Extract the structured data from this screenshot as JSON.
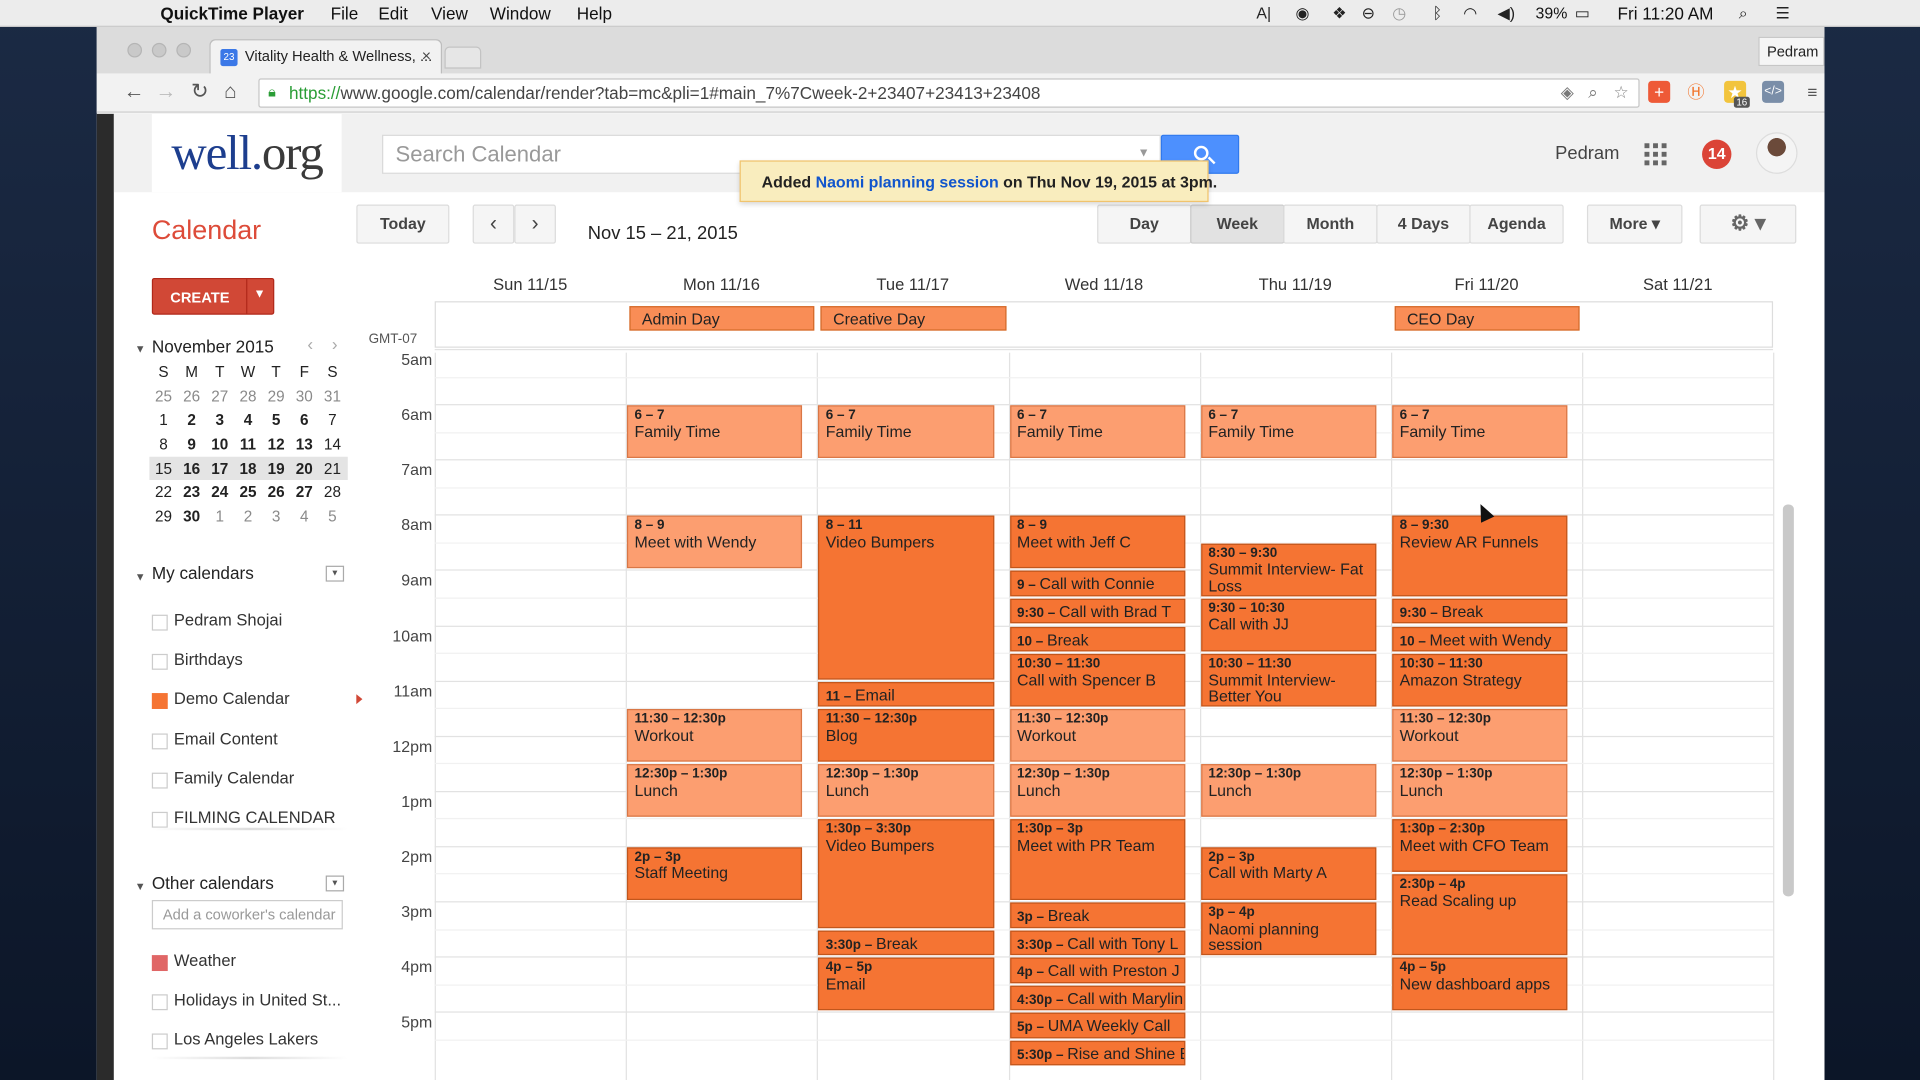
{
  "menubar": {
    "app_name": "QuickTime Player",
    "menus": [
      "File",
      "Edit",
      "View",
      "Window",
      "Help"
    ],
    "battery": "39%",
    "clock": "Fri 11:20 AM"
  },
  "browser": {
    "tab_title": "Vitality Health & Wellness, ...",
    "tab_favicon_text": "23",
    "profile_button": "Pedram",
    "url_https": "https://",
    "url_rest": "www.google.com/calendar/render?tab=mc&pli=1#main_7%7Cweek-2+23407+23413+23408",
    "extension_badge": "16"
  },
  "header": {
    "logo_main": "well.",
    "logo_suffix": "org",
    "search_placeholder": "Search Calendar",
    "user_name": "Pedram",
    "notification_count": "14"
  },
  "toast": {
    "prefix": "Added ",
    "event_name": "Naomi planning session",
    "suffix": " on Thu Nov 19, 2015 at 3pm."
  },
  "toolbar": {
    "title": "Calendar",
    "today": "Today",
    "prev_icon": "chevron-left-icon",
    "next_icon": "chevron-right-icon",
    "date_range": "Nov 15 – 21, 2015",
    "views": [
      "Day",
      "Week",
      "Month",
      "4 Days",
      "Agenda"
    ],
    "active_view": "Week",
    "more": "More ▾",
    "settings_icon": "gear-icon"
  },
  "sidebar": {
    "create": "CREATE",
    "month_title": "November 2015",
    "weekday_initials": [
      "S",
      "M",
      "T",
      "W",
      "T",
      "F",
      "S"
    ],
    "weeks": [
      [
        "25",
        "26",
        "27",
        "28",
        "29",
        "30",
        "31"
      ],
      [
        "1",
        "2",
        "3",
        "4",
        "5",
        "6",
        "7"
      ],
      [
        "8",
        "9",
        "10",
        "11",
        "12",
        "13",
        "14"
      ],
      [
        "15",
        "16",
        "17",
        "18",
        "19",
        "20",
        "21"
      ],
      [
        "22",
        "23",
        "24",
        "25",
        "26",
        "27",
        "28"
      ],
      [
        "29",
        "30",
        "1",
        "2",
        "3",
        "4",
        "5"
      ]
    ],
    "my_calendars_title": "My calendars",
    "my_calendars": [
      {
        "label": "Pedram Shojai",
        "color": ""
      },
      {
        "label": "Birthdays",
        "color": ""
      },
      {
        "label": "Demo Calendar",
        "color": "#f57433"
      },
      {
        "label": "Email Content",
        "color": ""
      },
      {
        "label": "Family Calendar",
        "color": ""
      },
      {
        "label": "FILMING CALENDAR",
        "color": ""
      }
    ],
    "other_calendars_title": "Other calendars",
    "add_coworker_placeholder": "Add a coworker's calendar",
    "other_calendars": [
      {
        "label": "Weather",
        "color": "#e06666"
      },
      {
        "label": "Holidays in United St...",
        "color": ""
      },
      {
        "label": "Los Angeles Lakers",
        "color": ""
      }
    ]
  },
  "week_view": {
    "timezone": "GMT-07",
    "days": [
      "Sun 11/15",
      "Mon 11/16",
      "Tue 11/17",
      "Wed 11/18",
      "Thu 11/19",
      "Fri 11/20",
      "Sat 11/21"
    ],
    "hours": [
      "5am",
      "6am",
      "7am",
      "8am",
      "9am",
      "10am",
      "11am",
      "12pm",
      "1pm",
      "2pm",
      "3pm",
      "4pm",
      "5pm"
    ],
    "all_day_events": [
      {
        "day": 1,
        "title": "Admin Day"
      },
      {
        "day": 2,
        "title": "Creative Day"
      },
      {
        "day": 5,
        "title": "CEO Day"
      }
    ],
    "events": [
      {
        "day": 1,
        "start": 6,
        "end": 7,
        "time": "6 – 7",
        "title": "Family Time",
        "shade": "light"
      },
      {
        "day": 2,
        "start": 6,
        "end": 7,
        "time": "6 – 7",
        "title": "Family Time",
        "shade": "light"
      },
      {
        "day": 3,
        "start": 6,
        "end": 7,
        "time": "6 – 7",
        "title": "Family Time",
        "shade": "light"
      },
      {
        "day": 4,
        "start": 6,
        "end": 7,
        "time": "6 – 7",
        "title": "Family Time",
        "shade": "light"
      },
      {
        "day": 5,
        "start": 6,
        "end": 7,
        "time": "6 – 7",
        "title": "Family Time",
        "shade": "light"
      },
      {
        "day": 1,
        "start": 8,
        "end": 9,
        "time": "8 – 9",
        "title": "Meet with Wendy",
        "shade": "light"
      },
      {
        "day": 1,
        "start": 11.5,
        "end": 12.5,
        "time": "11:30 – 12:30p",
        "title": "Workout",
        "shade": "light"
      },
      {
        "day": 1,
        "start": 12.5,
        "end": 13.5,
        "time": "12:30p – 1:30p",
        "title": "Lunch",
        "shade": "light"
      },
      {
        "day": 1,
        "start": 14,
        "end": 15,
        "time": "2p – 3p",
        "title": "Staff Meeting",
        "shade": "dark"
      },
      {
        "day": 2,
        "start": 8,
        "end": 11,
        "time": "8 – 11",
        "title": "Video Bumpers",
        "shade": "dark"
      },
      {
        "day": 2,
        "start": 11,
        "end": 11.5,
        "time": "11 – ",
        "title": "Email",
        "shade": "dark",
        "inline": true
      },
      {
        "day": 2,
        "start": 11.5,
        "end": 12.5,
        "time": "11:30 – 12:30p",
        "title": "Blog",
        "shade": "dark"
      },
      {
        "day": 2,
        "start": 12.5,
        "end": 13.5,
        "time": "12:30p – 1:30p",
        "title": "Lunch",
        "shade": "light"
      },
      {
        "day": 2,
        "start": 13.5,
        "end": 15.5,
        "time": "1:30p – 3:30p",
        "title": "Video Bumpers",
        "shade": "dark"
      },
      {
        "day": 2,
        "start": 15.5,
        "end": 16,
        "time": "3:30p – ",
        "title": "Break",
        "shade": "dark",
        "inline": true
      },
      {
        "day": 2,
        "start": 16,
        "end": 17,
        "time": "4p – 5p",
        "title": "Email",
        "shade": "dark"
      },
      {
        "day": 3,
        "start": 8,
        "end": 9,
        "time": "8 – 9",
        "title": "Meet with Jeff C",
        "shade": "dark"
      },
      {
        "day": 3,
        "start": 9,
        "end": 9.5,
        "time": "9 – ",
        "title": "Call with Connie",
        "shade": "dark",
        "inline": true
      },
      {
        "day": 3,
        "start": 9.5,
        "end": 10,
        "time": "9:30 – ",
        "title": "Call with Brad T",
        "shade": "dark",
        "inline": true
      },
      {
        "day": 3,
        "start": 10,
        "end": 10.5,
        "time": "10 – ",
        "title": "Break",
        "shade": "dark",
        "inline": true
      },
      {
        "day": 3,
        "start": 10.5,
        "end": 11.5,
        "time": "10:30 – 11:30",
        "title": "Call with Spencer B",
        "shade": "dark"
      },
      {
        "day": 3,
        "start": 11.5,
        "end": 12.5,
        "time": "11:30 – 12:30p",
        "title": "Workout",
        "shade": "light"
      },
      {
        "day": 3,
        "start": 12.5,
        "end": 13.5,
        "time": "12:30p – 1:30p",
        "title": "Lunch",
        "shade": "light"
      },
      {
        "day": 3,
        "start": 13.5,
        "end": 15,
        "time": "1:30p – 3p",
        "title": "Meet with PR Team",
        "shade": "dark"
      },
      {
        "day": 3,
        "start": 15,
        "end": 15.5,
        "time": "3p – ",
        "title": "Break",
        "shade": "dark",
        "inline": true
      },
      {
        "day": 3,
        "start": 15.5,
        "end": 16,
        "time": "3:30p – ",
        "title": "Call with Tony L",
        "shade": "dark",
        "inline": true
      },
      {
        "day": 3,
        "start": 16,
        "end": 16.5,
        "time": "4p – ",
        "title": "Call with Preston J",
        "shade": "dark",
        "inline": true
      },
      {
        "day": 3,
        "start": 16.5,
        "end": 17,
        "time": "4:30p – ",
        "title": "Call with Marylin",
        "shade": "dark",
        "inline": true
      },
      {
        "day": 3,
        "start": 17,
        "end": 17.5,
        "time": "5p – ",
        "title": "UMA Weekly Call",
        "shade": "dark",
        "inline": true
      },
      {
        "day": 3,
        "start": 17.5,
        "end": 18,
        "time": "5:30p – ",
        "title": "Rise and Shine E",
        "shade": "dark",
        "inline": true
      },
      {
        "day": 4,
        "start": 8.5,
        "end": 9.5,
        "time": "8:30 – 9:30",
        "title": "Summit Interview- Fat Loss",
        "shade": "dark"
      },
      {
        "day": 4,
        "start": 9.5,
        "end": 10.5,
        "time": "9:30 – 10:30",
        "title": "Call with JJ",
        "shade": "dark"
      },
      {
        "day": 4,
        "start": 10.5,
        "end": 11.5,
        "time": "10:30 – 11:30",
        "title": "Summit Interview- Better You",
        "shade": "dark"
      },
      {
        "day": 4,
        "start": 12.5,
        "end": 13.5,
        "time": "12:30p – 1:30p",
        "title": "Lunch",
        "shade": "light"
      },
      {
        "day": 4,
        "start": 14,
        "end": 15,
        "time": "2p – 3p",
        "title": "Call with Marty A",
        "shade": "dark"
      },
      {
        "day": 4,
        "start": 15,
        "end": 16,
        "time": "3p – 4p",
        "title": "Naomi planning session",
        "shade": "dark"
      },
      {
        "day": 5,
        "start": 8,
        "end": 9.5,
        "time": "8 – 9:30",
        "title": "Review AR Funnels",
        "shade": "dark"
      },
      {
        "day": 5,
        "start": 9.5,
        "end": 10,
        "time": "9:30 – ",
        "title": "Break",
        "shade": "dark",
        "inline": true
      },
      {
        "day": 5,
        "start": 10,
        "end": 10.5,
        "time": "10 – ",
        "title": "Meet with Wendy",
        "shade": "dark",
        "inline": true
      },
      {
        "day": 5,
        "start": 10.5,
        "end": 11.5,
        "time": "10:30 – 11:30",
        "title": "Amazon Strategy",
        "shade": "dark"
      },
      {
        "day": 5,
        "start": 11.5,
        "end": 12.5,
        "time": "11:30 – 12:30p",
        "title": "Workout",
        "shade": "light"
      },
      {
        "day": 5,
        "start": 12.5,
        "end": 13.5,
        "time": "12:30p – 1:30p",
        "title": "Lunch",
        "shade": "light"
      },
      {
        "day": 5,
        "start": 13.5,
        "end": 14.5,
        "time": "1:30p – 2:30p",
        "title": "Meet with CFO Team",
        "shade": "dark"
      },
      {
        "day": 5,
        "start": 14.5,
        "end": 16,
        "time": "2:30p – 4p",
        "title": "Read Scaling up",
        "shade": "dark"
      },
      {
        "day": 5,
        "start": 16,
        "end": 17,
        "time": "4p – 5p",
        "title": "New dashboard apps",
        "shade": "dark"
      }
    ]
  }
}
